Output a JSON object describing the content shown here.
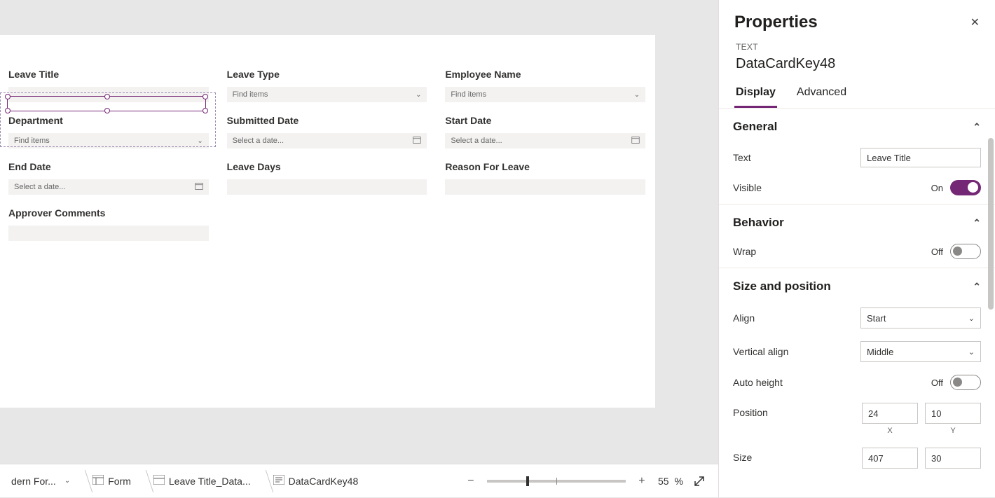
{
  "form": {
    "cards": [
      {
        "label": "Leave Title",
        "placeholder": "",
        "kind": "text",
        "selected": true
      },
      {
        "label": "Leave Type",
        "placeholder": "Find items",
        "kind": "select"
      },
      {
        "label": "Employee Name",
        "placeholder": "Find items",
        "kind": "select"
      },
      {
        "label": "Department",
        "placeholder": "Find items",
        "kind": "select"
      },
      {
        "label": "Submitted Date",
        "placeholder": "Select a date...",
        "kind": "date"
      },
      {
        "label": "Start Date",
        "placeholder": "Select a date...",
        "kind": "date"
      },
      {
        "label": "End Date",
        "placeholder": "Select a date...",
        "kind": "date"
      },
      {
        "label": "Leave Days",
        "placeholder": "",
        "kind": "text"
      },
      {
        "label": "Reason For Leave",
        "placeholder": "",
        "kind": "text"
      },
      {
        "label": "Approver Comments",
        "placeholder": "",
        "kind": "text"
      }
    ]
  },
  "properties": {
    "panel_title": "Properties",
    "type_label": "TEXT",
    "element_name": "DataCardKey48",
    "tabs": {
      "display": "Display",
      "advanced": "Advanced"
    },
    "sections": {
      "general": {
        "title": "General",
        "text_label": "Text",
        "text_value": "Leave Title",
        "visible_label": "Visible",
        "visible_state": "On"
      },
      "behavior": {
        "title": "Behavior",
        "wrap_label": "Wrap",
        "wrap_state": "Off"
      },
      "sizepos": {
        "title": "Size and position",
        "align_label": "Align",
        "align_value": "Start",
        "valign_label": "Vertical align",
        "valign_value": "Middle",
        "autoheight_label": "Auto height",
        "autoheight_state": "Off",
        "position_label": "Position",
        "position_x": "24",
        "position_y": "10",
        "x_label": "X",
        "y_label": "Y",
        "size_label": "Size",
        "size_w": "407",
        "size_h": "30"
      }
    }
  },
  "breadcrumb": {
    "items": [
      {
        "label": "dern For..."
      },
      {
        "label": "Form"
      },
      {
        "label": "Leave Title_Data..."
      },
      {
        "label": "DataCardKey48"
      }
    ]
  },
  "zoom": {
    "value": "55",
    "pct": "%"
  }
}
